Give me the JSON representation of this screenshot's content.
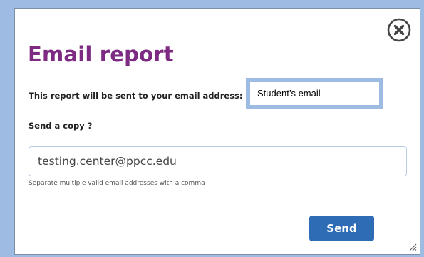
{
  "dialog": {
    "title": "Email report",
    "close_icon": "close-circle-icon",
    "report_label": "This report will be sent to your email address:",
    "student_email": "Student’s email",
    "copy_label": "Send a copy ?",
    "copy_input_value": "testing.center@ppcc.edu",
    "helper_text": "Separate multiple valid email addresses with a comma",
    "send_label": "Send",
    "resize_icon": "resize-grip-icon"
  },
  "colors": {
    "title": "#7d2a83",
    "send_button": "#2e6db5",
    "highlight_frame": "#9dbbe3",
    "background": "#9dbbe3"
  }
}
